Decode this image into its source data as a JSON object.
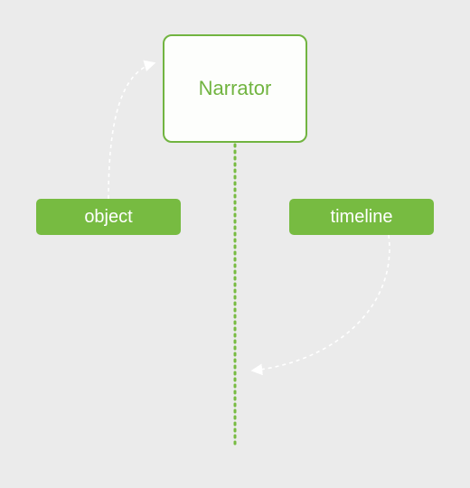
{
  "diagram": {
    "main_node": {
      "label": "Narrator"
    },
    "left_chip": {
      "label": "object"
    },
    "right_chip": {
      "label": "timeline"
    },
    "colors": {
      "accent": "#77bb41",
      "border": "#71b440",
      "background": "#ebebeb",
      "node_fill": "#fdfefc"
    }
  }
}
